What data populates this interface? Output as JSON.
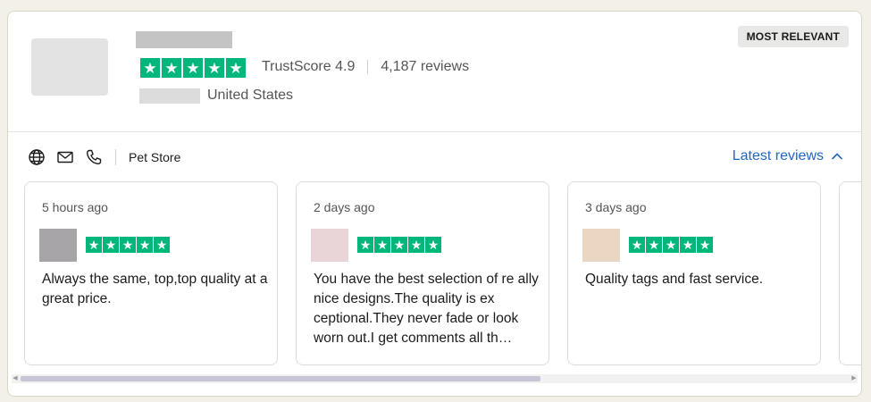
{
  "business": {
    "trustscore_label": "TrustScore 4.9",
    "reviews_count": "4,187 reviews",
    "country": "United States",
    "rating_stars": 5,
    "category": "Pet Store"
  },
  "sort_badge": "MOST RELEVANT",
  "latest_reviews_label": "Latest reviews",
  "colors": {
    "star_green": "#00b67a",
    "link_blue": "#2266c4"
  },
  "icons": [
    "globe-icon",
    "mail-icon",
    "phone-icon",
    "chevron-up-icon",
    "star-icon"
  ],
  "reviews": [
    {
      "time": "5 hours ago",
      "stars": 5,
      "text": "Always the same, top,top quality at a great price.",
      "avatar_color": "#a8a5a8"
    },
    {
      "time": "2 days ago",
      "stars": 5,
      "text": "You have the best selection of re ally nice designs.The quality is ex ceptional.They never fade or look worn out.I get comments all th…",
      "avatar_color": "#e9d4d8"
    },
    {
      "time": "3 days ago",
      "stars": 5,
      "text": "Quality tags and fast service.",
      "avatar_color": "#ebd6c3"
    }
  ]
}
